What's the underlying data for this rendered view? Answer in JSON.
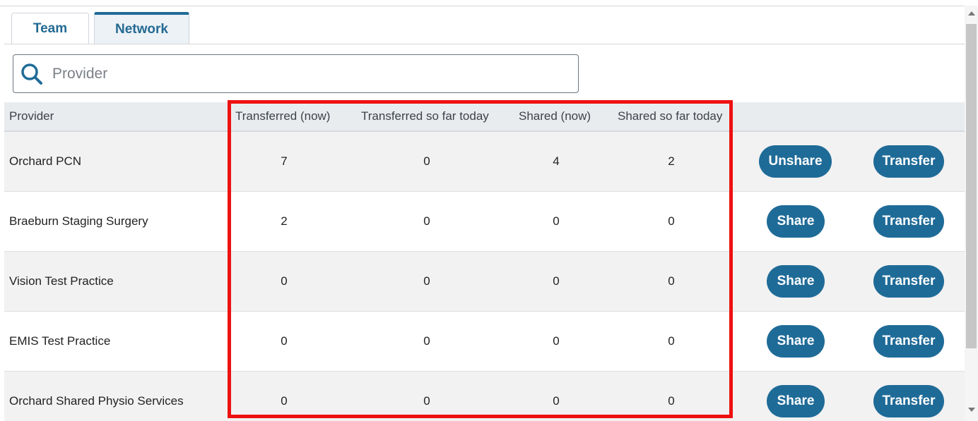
{
  "tabs": [
    {
      "label": "Team"
    },
    {
      "label": "Network"
    }
  ],
  "search": {
    "placeholder": "Provider",
    "value": ""
  },
  "table": {
    "headers": {
      "provider": "Provider",
      "transferred_now": "Transferred (now)",
      "transferred_today": "Transferred so far today",
      "shared_now": "Shared (now)",
      "shared_today": "Shared so far today"
    },
    "rows": [
      {
        "provider": "Orchard PCN",
        "transferred_now": "7",
        "transferred_today": "0",
        "shared_now": "4",
        "shared_today": "2",
        "share_action": "Unshare",
        "transfer_action": "Transfer"
      },
      {
        "provider": "Braeburn Staging Surgery",
        "transferred_now": "2",
        "transferred_today": "0",
        "shared_now": "0",
        "shared_today": "0",
        "share_action": "Share",
        "transfer_action": "Transfer"
      },
      {
        "provider": "Vision Test Practice",
        "transferred_now": "0",
        "transferred_today": "0",
        "shared_now": "0",
        "shared_today": "0",
        "share_action": "Share",
        "transfer_action": "Transfer"
      },
      {
        "provider": "EMIS Test Practice",
        "transferred_now": "0",
        "transferred_today": "0",
        "shared_now": "0",
        "shared_today": "0",
        "share_action": "Share",
        "transfer_action": "Transfer"
      },
      {
        "provider": "Orchard Shared Physio Services",
        "transferred_now": "0",
        "transferred_today": "0",
        "shared_now": "0",
        "shared_today": "0",
        "share_action": "Share",
        "transfer_action": "Transfer"
      }
    ]
  },
  "icons": {
    "search": "search-icon"
  },
  "colors": {
    "accent": "#1f6b98",
    "highlight": "#ee1111",
    "tab_text": "#236a93"
  }
}
